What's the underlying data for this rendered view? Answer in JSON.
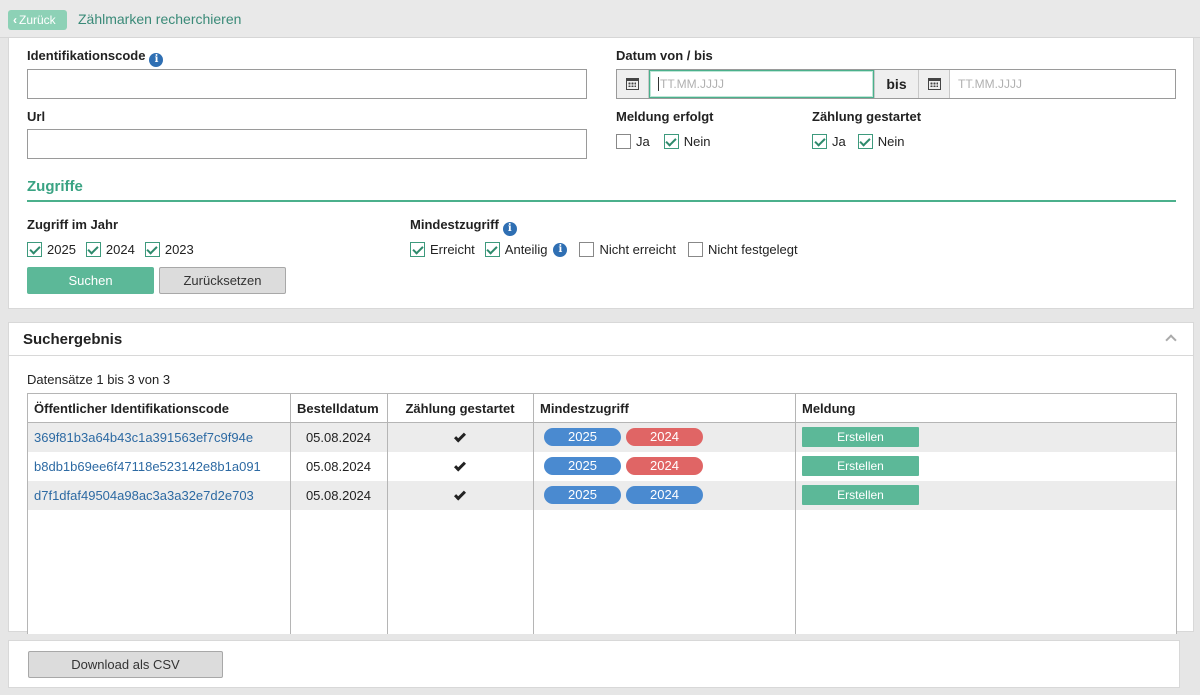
{
  "header": {
    "back_label": "Zurück",
    "title": "Zählmarken recherchieren"
  },
  "filters": {
    "ident_label": "Identifikationscode",
    "ident_value": "",
    "url_label": "Url",
    "url_value": "",
    "date_label": "Datum von / bis",
    "date_from_placeholder": "TT.MM.JJJJ",
    "date_bis": "bis",
    "date_to_placeholder": "TT.MM.JJJJ",
    "meldung_label": "Meldung erfolgt",
    "meldung_options": [
      {
        "label": "Ja",
        "checked": false
      },
      {
        "label": "Nein",
        "checked": true
      }
    ],
    "zahlung_label": "Zählung gestartet",
    "zahlung_options": [
      {
        "label": "Ja",
        "checked": true
      },
      {
        "label": "Nein",
        "checked": true
      }
    ]
  },
  "zugriffe": {
    "section_title": "Zugriffe",
    "year_label": "Zugriff im Jahr",
    "years": [
      {
        "label": "2025",
        "checked": true
      },
      {
        "label": "2024",
        "checked": true
      },
      {
        "label": "2023",
        "checked": true
      }
    ],
    "min_label": "Mindestzugriff",
    "min_options": [
      {
        "label": "Erreicht",
        "checked": true
      },
      {
        "label": "Anteilig",
        "checked": true,
        "info": true
      },
      {
        "label": "Nicht erreicht",
        "checked": false
      },
      {
        "label": "Nicht festgelegt",
        "checked": false
      }
    ],
    "search_label": "Suchen",
    "reset_label": "Zurücksetzen"
  },
  "results": {
    "title": "Suchergebnis",
    "records_text": "Datensätze 1 bis 3 von 3",
    "columns": [
      "Öffentlicher Identifikationscode",
      "Bestelldatum",
      "Zählung gestartet",
      "Mindestzugriff",
      "Meldung"
    ],
    "rows": [
      {
        "code": "369f81b3a64b43c1a391563ef7c9f94e",
        "date": "05.08.2024",
        "started": true,
        "badges": [
          {
            "label": "2025",
            "color": "#4a8ad0"
          },
          {
            "label": "2024",
            "color": "#e06565"
          }
        ],
        "action": "Erstellen"
      },
      {
        "code": "b8db1b69ee6f47118e523142e8b1a091",
        "date": "05.08.2024",
        "started": true,
        "badges": [
          {
            "label": "2025",
            "color": "#4a8ad0"
          },
          {
            "label": "2024",
            "color": "#e06565"
          }
        ],
        "action": "Erstellen"
      },
      {
        "code": "d7f1dfaf49504a98ac3a3a32e7d2e703",
        "date": "05.08.2024",
        "started": true,
        "badges": [
          {
            "label": "2025",
            "color": "#4a8ad0"
          },
          {
            "label": "2024",
            "color": "#4a8ad0"
          }
        ],
        "action": "Erstellen"
      }
    ]
  },
  "footer": {
    "csv_label": "Download als CSV"
  },
  "colors": {
    "accent": "#5cb898",
    "badge_ok": "#4a8ad0",
    "badge_missing": "#e06565",
    "link": "#2d6aa3"
  }
}
